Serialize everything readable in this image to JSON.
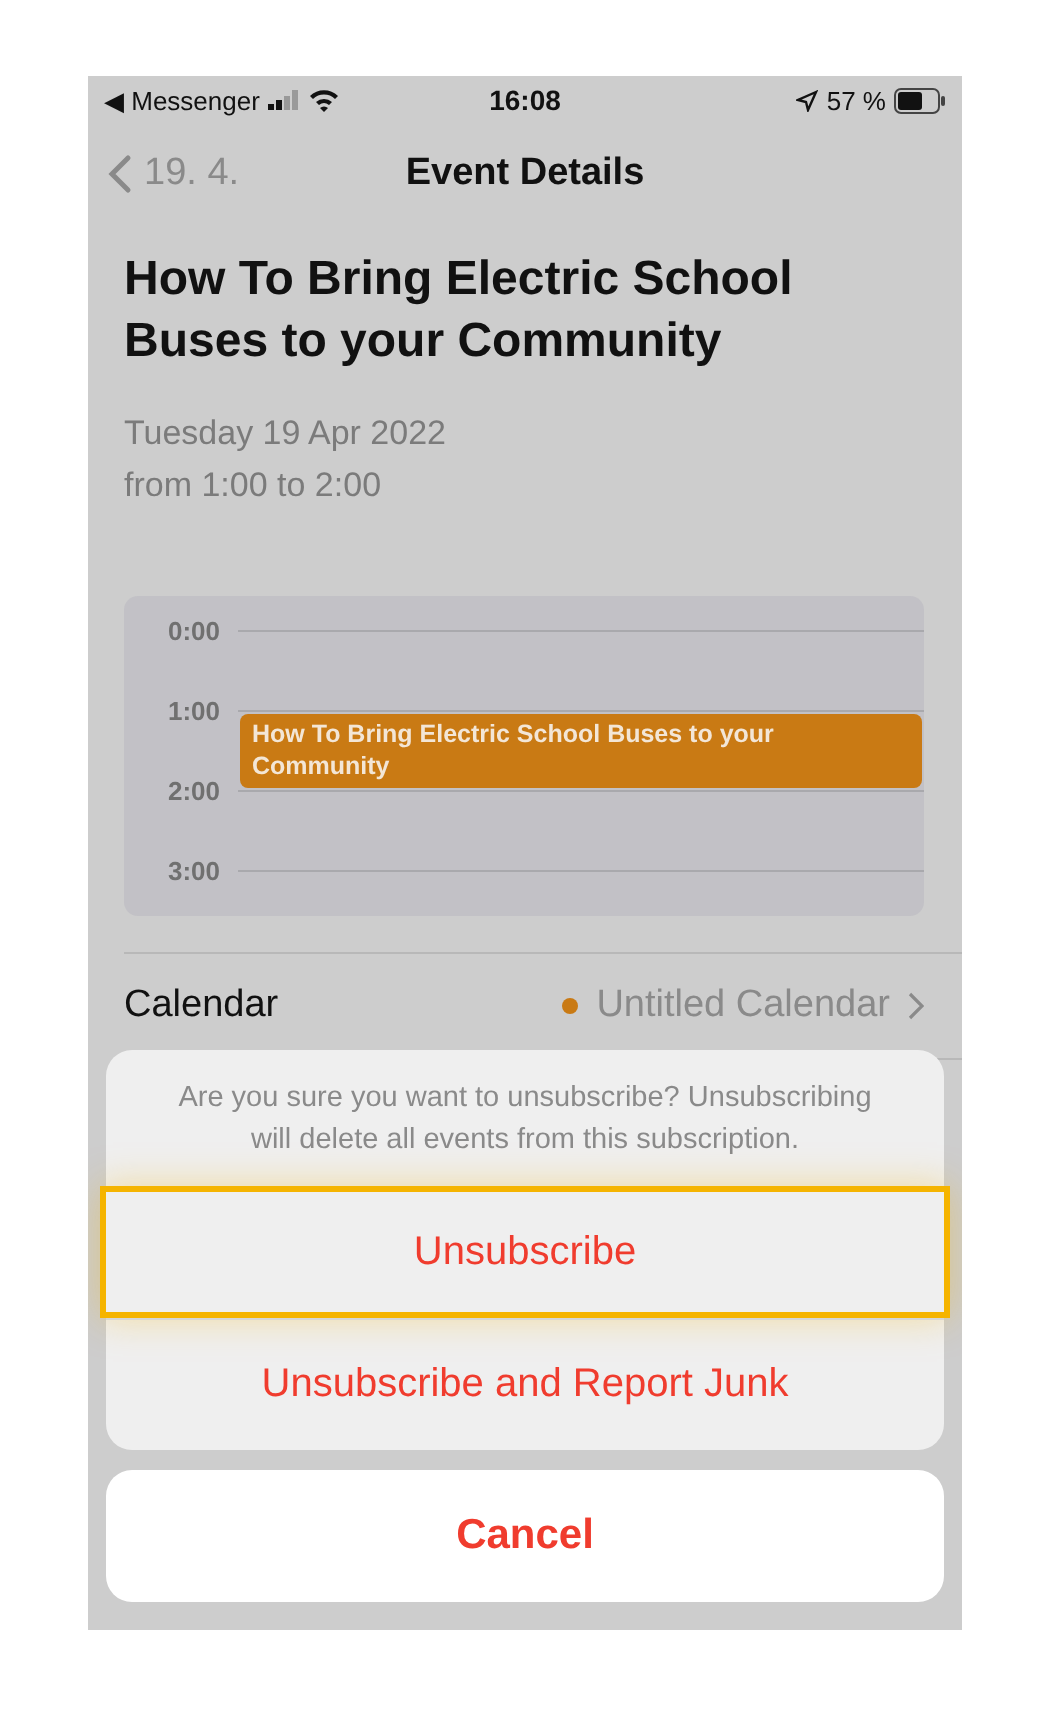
{
  "status_bar": {
    "back_app": "◀ Messenger",
    "time": "16:08",
    "battery": "57 %"
  },
  "nav": {
    "back": "19. 4.",
    "title": "Event Details"
  },
  "event": {
    "title": "How To Bring Electric School Buses to your Community",
    "date": "Tuesday 19 Apr 2022",
    "time": "from 1:00 to 2:00"
  },
  "timeline": {
    "hours": [
      "0:00",
      "1:00",
      "2:00",
      "3:00"
    ],
    "event": {
      "title": "How To Bring Electric School Buses to your Community",
      "color": "#c97a14"
    }
  },
  "calendar_row": {
    "label": "Calendar",
    "value": "Untitled Calendar",
    "color": "#c97a14"
  },
  "action_sheet": {
    "message": "Are you sure you want to unsubscribe? Unsubscribing will delete all events from this subscription.",
    "actions": [
      {
        "label": "Unsubscribe",
        "highlighted": true
      },
      {
        "label": "Unsubscribe and Report Junk",
        "highlighted": false
      }
    ],
    "cancel": "Cancel"
  }
}
